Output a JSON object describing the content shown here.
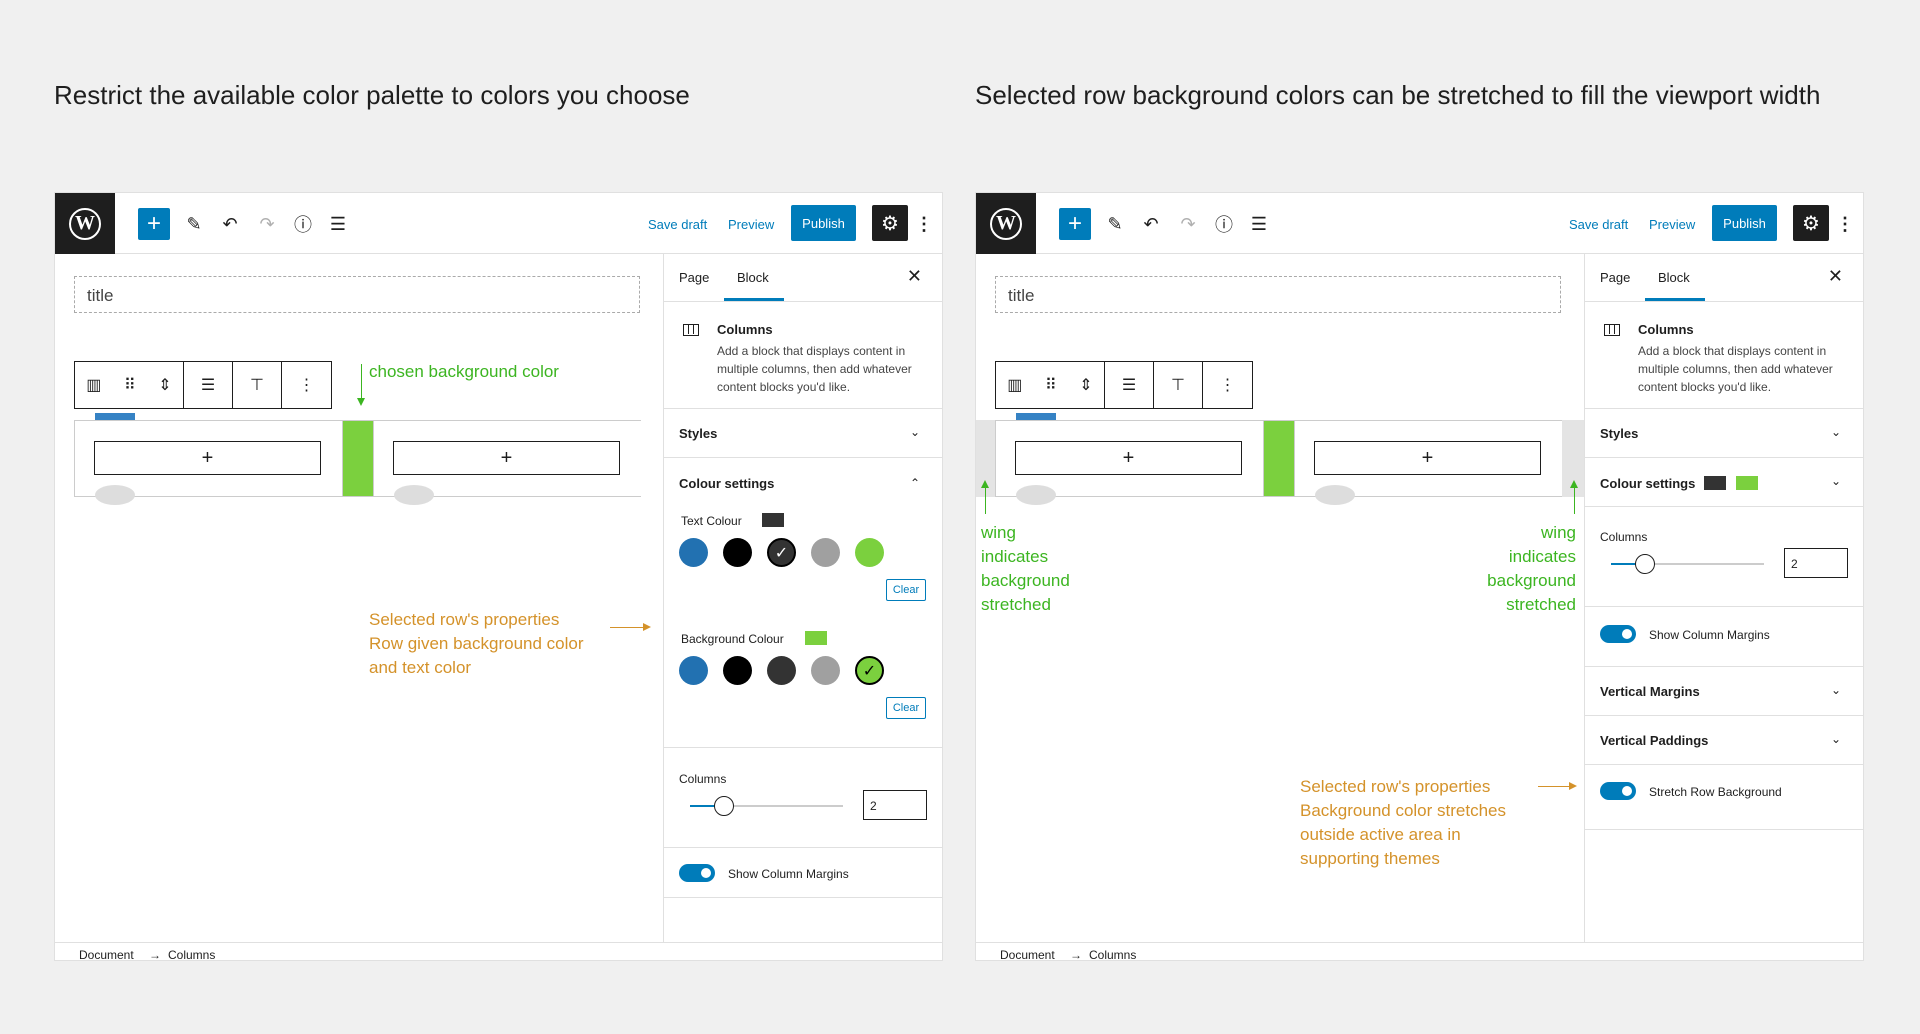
{
  "headings": {
    "left": "Restrict the available color palette to colors you choose",
    "right": "Selected row background colors can be stretched to fill the viewport width"
  },
  "toolbar": {
    "add_icon": "+",
    "save_draft": "Save draft",
    "preview": "Preview",
    "publish": "Publish",
    "settings_icon": "⚙",
    "more_icon": "⋮"
  },
  "editor": {
    "title": "title",
    "add_block": "+"
  },
  "sidebar": {
    "tab_page": "Page",
    "tab_block": "Block",
    "close": "✕",
    "block_name": "Columns",
    "block_desc": "Add a block that displays content in multiple columns, then add whatever content blocks you'd like.",
    "styles": "Styles",
    "colour_settings": "Colour settings",
    "text_colour": "Text Colour",
    "background_colour": "Background Colour",
    "clear": "Clear",
    "columns": "Columns",
    "columns_value": "2",
    "show_column_margins": "Show Column Margins",
    "vertical_margins": "Vertical Margins",
    "vertical_paddings": "Vertical Paddings",
    "stretch_row_background": "Stretch Row Background"
  },
  "colors": {
    "blue": "#2271b1",
    "black": "#000000",
    "dark": "#333333",
    "grey": "#a0a0a0",
    "green": "#7bd03e",
    "accent": "#007cba"
  },
  "annotations": {
    "chosen_bg": "chosen background color",
    "left_row_props": [
      "Selected row's properties",
      "Row given background color",
      "and text color"
    ],
    "wing_left": [
      "wing",
      "indicates",
      "background",
      "stretched"
    ],
    "wing_right": [
      "wing",
      "indicates",
      "background",
      "stretched"
    ],
    "right_row_props": [
      "Selected row's properties",
      "Background color stretches",
      "outside active area in",
      "supporting themes"
    ]
  },
  "footer": {
    "document": "Document",
    "sep": "→",
    "columns": "Columns"
  }
}
